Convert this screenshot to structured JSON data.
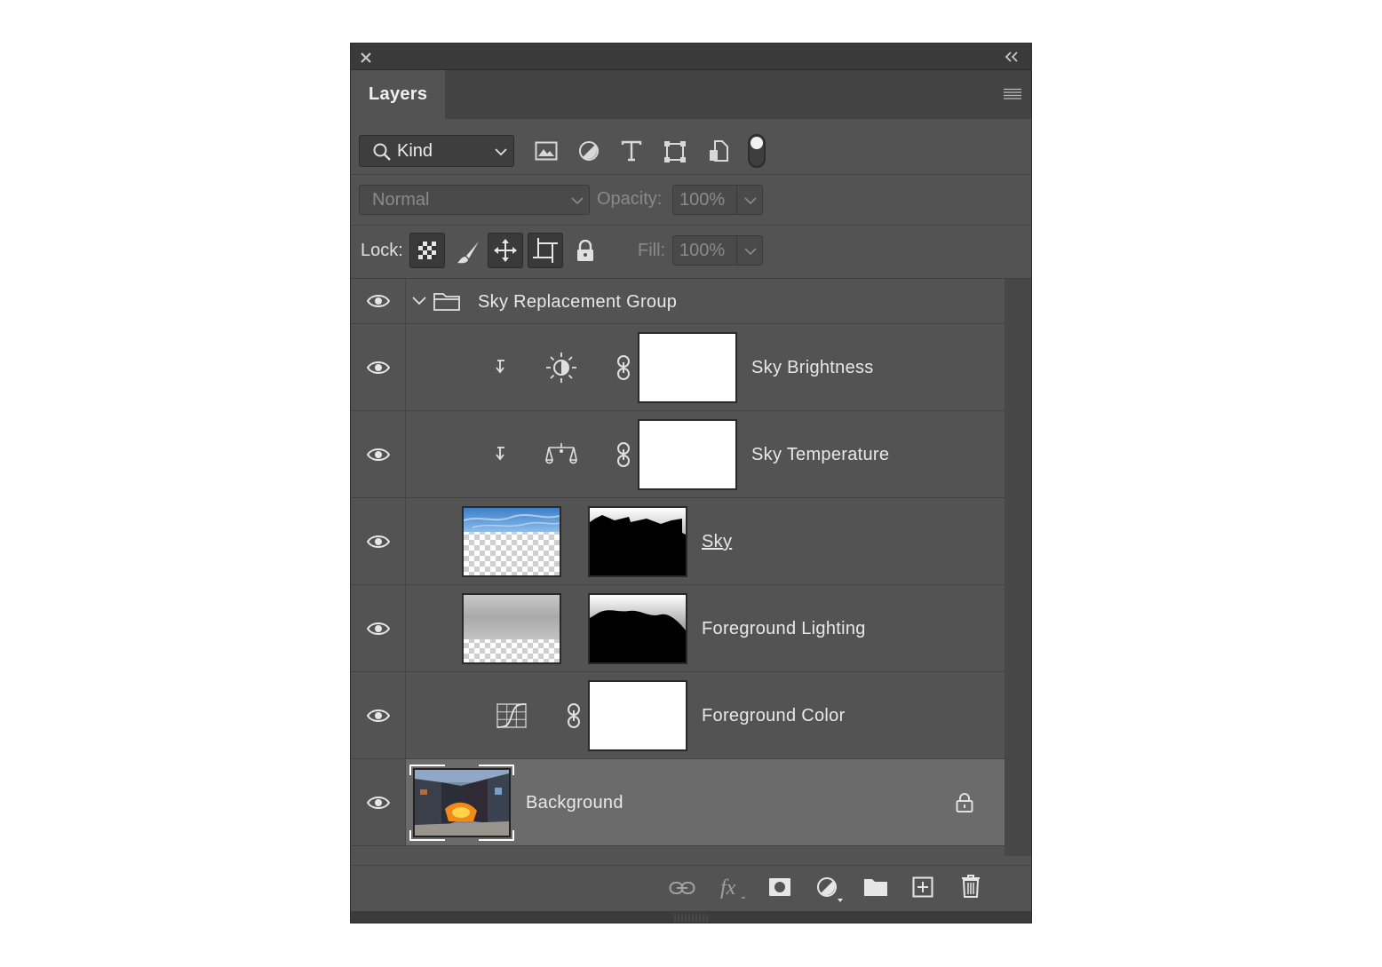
{
  "panel": {
    "tab_label": "Layers",
    "close_icon": "close-icon",
    "collapse_icon": "collapse-double-chevron-icon",
    "menu_icon": "panel-menu-icon"
  },
  "filter": {
    "kind_label": "Kind",
    "filter_icons": [
      "image-filter-icon",
      "adjustment-filter-icon",
      "type-filter-icon",
      "shape-filter-icon",
      "smart-object-filter-icon"
    ],
    "toggle": "on"
  },
  "blend": {
    "mode": "Normal",
    "opacity_label": "Opacity:",
    "opacity_value": "100%",
    "fill_label": "Fill:",
    "fill_value": "100%"
  },
  "lock": {
    "label": "Lock:"
  },
  "layers": [
    {
      "name": "Sky Replacement Group",
      "type": "group"
    },
    {
      "name": "Sky Brightness",
      "type": "adjustment-brightness"
    },
    {
      "name": "Sky Temperature",
      "type": "adjustment-color-balance"
    },
    {
      "name": "Sky",
      "type": "pixel-mask"
    },
    {
      "name": "Foreground Lighting",
      "type": "pixel-mask"
    },
    {
      "name": "Foreground Color",
      "type": "adjustment-curves"
    },
    {
      "name": "Background",
      "type": "background",
      "locked": true,
      "selected": true
    }
  ],
  "colors": {
    "panel_bg": "#535353",
    "selected_row": "#6b6b6b",
    "title_bar": "#3a3a3a"
  }
}
